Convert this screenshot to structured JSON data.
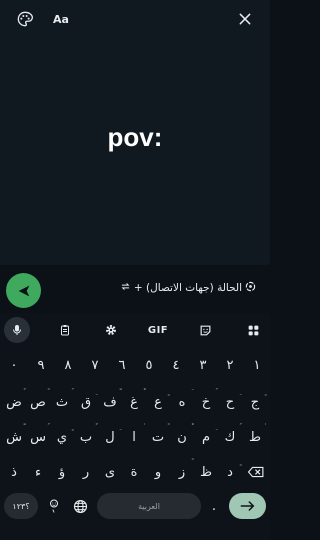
{
  "editor": {
    "status_text": "pov:",
    "font_button_label": "Aa"
  },
  "privacy": {
    "audience_label": "الحالة (جهات الاتصال) +"
  },
  "keyboard": {
    "gif_label": "GIF",
    "numbers": [
      "١",
      "٢",
      "٣",
      "٤",
      "٥",
      "٦",
      "٧",
      "٨",
      "٩",
      "٠"
    ],
    "row1": [
      "ض",
      "ص",
      "ث",
      "ق",
      "ف",
      "غ",
      "ع",
      "ه",
      "خ",
      "ح",
      "ج"
    ],
    "row1_hints": [
      "ٌ",
      "ً",
      "ُ",
      "ِ",
      "ّ",
      "ْ",
      "ٍ",
      "َ",
      "ُ",
      "ِ",
      "ٍ"
    ],
    "row2": [
      "ش",
      "س",
      "ي",
      "ب",
      "ل",
      "ا",
      "ت",
      "ن",
      "م",
      "ك",
      "ط"
    ],
    "row2_hints": [
      "ّ",
      "ُ",
      "ٍ",
      "ٌ",
      "ِ",
      "ٰ",
      "ً",
      "ْ",
      "ِ",
      "ُ",
      "ٰ"
    ],
    "row3": [
      "ذ",
      "ء",
      "ؤ",
      "ر",
      "ى",
      "ة",
      "و",
      "ز",
      "ظ",
      "د"
    ],
    "row3_hints": [
      "",
      "",
      "",
      "",
      "",
      "",
      "",
      "ً",
      "",
      "ٍ"
    ],
    "key_123_label": "؟١٢٣",
    "space_label": "العربية",
    "dot_label": "."
  },
  "colors": {
    "send_fab": "#3fa95d",
    "enter_key": "#9fc7b3"
  }
}
